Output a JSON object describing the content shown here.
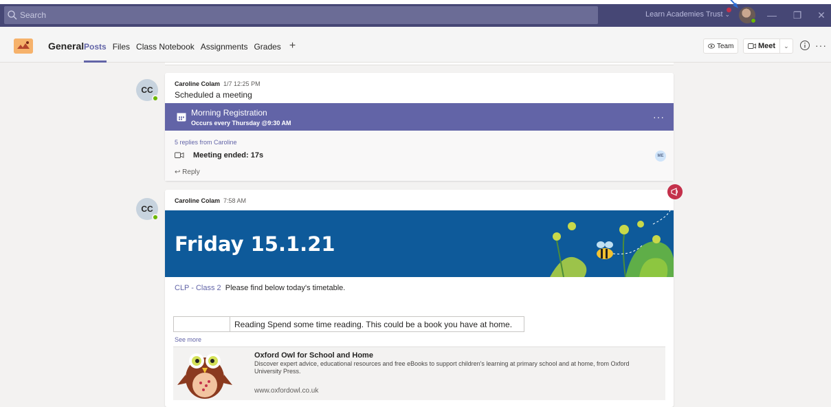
{
  "titlebar": {
    "search_placeholder": "Search",
    "org_name": "Learn Academies Trust",
    "minimize": "—",
    "maximize": "❐",
    "close": "✕"
  },
  "header": {
    "channel_name": "General",
    "tabs": [
      {
        "label": "Posts",
        "active": true
      },
      {
        "label": "Files",
        "active": false
      },
      {
        "label": "Class Notebook",
        "active": false
      },
      {
        "label": "Assignments",
        "active": false
      },
      {
        "label": "Grades",
        "active": false
      }
    ],
    "add_tab": "+",
    "team_label": "Team",
    "meet_label": "Meet",
    "more": "···"
  },
  "posts": [
    {
      "avatar_initials": "CC",
      "author": "Caroline Colam",
      "timestamp": "1/7 12:25 PM",
      "text": "Scheduled a meeting",
      "meeting": {
        "title": "Morning Registration",
        "recurrence": "Occurs every Thursday @9:30 AM",
        "more": "···"
      },
      "replies_link": "5 replies from Caroline",
      "meeting_ended": "Meeting ended: 17s",
      "participant_initials": "ME",
      "reply_label": "Reply"
    },
    {
      "avatar_initials": "CC",
      "author": "Caroline Colam",
      "timestamp": "7:58 AM",
      "banner_text": "Friday 15.1.21",
      "mention": "CLP - Class 2",
      "text": "Please find below today's timetable.",
      "table_cell": "Reading Spend some time reading. This could be a book you have at home.",
      "see_more": "See more",
      "card": {
        "title": "Oxford Owl for School and Home",
        "description": "Discover expert advice, educational resources and free eBooks to support children's learning at primary school and at home, from Oxford University Press.",
        "url": "www.oxfordowl.co.uk"
      }
    }
  ],
  "colors": {
    "titlebar": "#464775",
    "accent": "#6264a7",
    "banner": "#0e5a9a",
    "presence": "#6bb700",
    "announce": "#c4314b"
  }
}
